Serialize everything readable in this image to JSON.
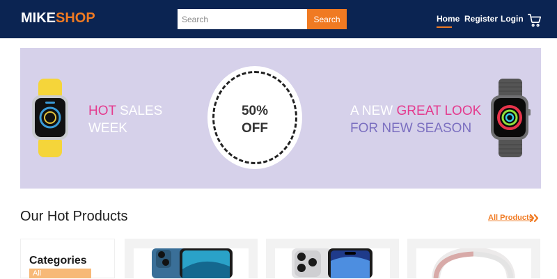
{
  "header": {
    "logo_part1": "MIKE",
    "logo_part2": "SHOP",
    "search_placeholder": "Search",
    "search_button": "Search",
    "nav": {
      "home": "Home",
      "register": "Register",
      "login": "Login"
    },
    "cart_icon": "shopping-cart-icon",
    "active_nav": "Home"
  },
  "banner": {
    "left_hot": "HOT",
    "left_sales": "SALES",
    "left_week": "WEEK",
    "discount_pct": "50%",
    "discount_off": "OFF",
    "right_a_new": "A NEW",
    "right_great_look": "GREAT LOOK",
    "right_season": "FOR NEW SEASON",
    "left_image": "yellow-smartwatch",
    "right_image": "black-smartwatch"
  },
  "section": {
    "title": "Our Hot Products",
    "all_products": "All Products",
    "all_products_icon": "double-chevron-right-icon"
  },
  "categories": {
    "title": "Categories",
    "items": [
      "All"
    ]
  },
  "products": [
    {
      "image": "iphone-13-blue"
    },
    {
      "image": "iphone-14-pro-silver"
    },
    {
      "image": "pink-headphones"
    }
  ],
  "colors": {
    "header_bg": "#0b2452",
    "accent": "#f07a22",
    "banner_bg": "#d6d1ea",
    "pink": "#e43b8e",
    "purple": "#7b6fc0"
  }
}
